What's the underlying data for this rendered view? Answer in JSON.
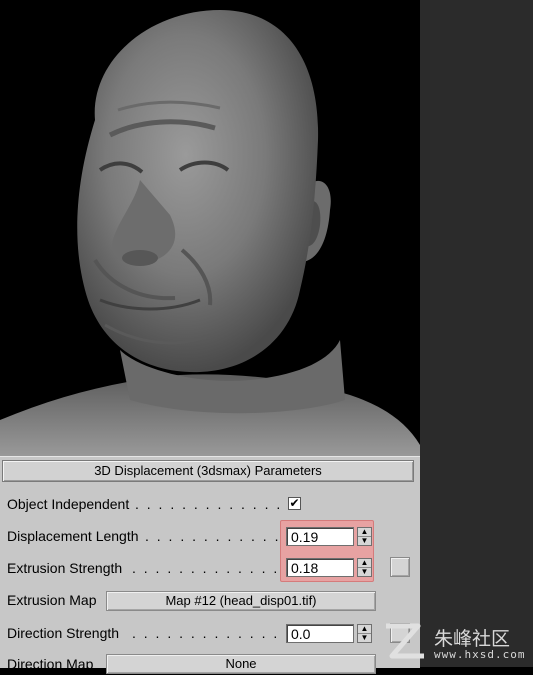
{
  "rollout": {
    "title": "3D Displacement (3dsmax) Parameters",
    "object_independent": {
      "label": "Object Independent",
      "checked": true,
      "check_glyph": "✔"
    },
    "displacement_length": {
      "label": "Displacement Length",
      "value": "0.19"
    },
    "extrusion_strength": {
      "label": "Extrusion Strength",
      "value": "0.18"
    },
    "extrusion_map": {
      "label": "Extrusion Map",
      "button": "Map #12 (head_disp01.tif)"
    },
    "direction_strength": {
      "label": "Direction Strength",
      "value": "0.0"
    },
    "direction_map": {
      "label": "Direction Map",
      "button": "None"
    }
  },
  "spinner_arrows": {
    "up": "▲",
    "down": "▼"
  },
  "watermark": {
    "brand": "朱峰社区",
    "url": "www.hxsd.com"
  },
  "colors": {
    "highlight": "#e7a2a2",
    "panel": "#c7c7c7",
    "viewport_bg": "#000000",
    "side_bg": "#2b2b2b"
  }
}
